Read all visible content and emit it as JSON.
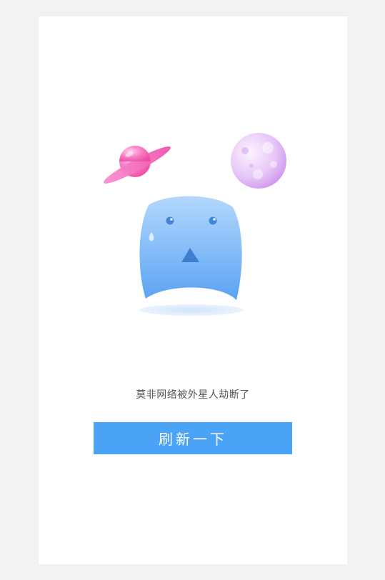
{
  "error_state": {
    "message": "莫非网络被外星人劫断了",
    "refresh_button_label": "刷新一下"
  },
  "icons": [
    "ringed-planet-icon",
    "moon-icon",
    "sad-ghost-icon"
  ],
  "colors": {
    "page_background": "#f2f2f2",
    "card_background": "#ffffff",
    "button_background": "#4aa3f5",
    "button_text": "#ffffff",
    "message_text": "#555555",
    "ghost_top": "#a9d3fb",
    "ghost_bottom": "#5ea6f5",
    "planet": "#f468b8",
    "moon": "#d6a8f0"
  }
}
